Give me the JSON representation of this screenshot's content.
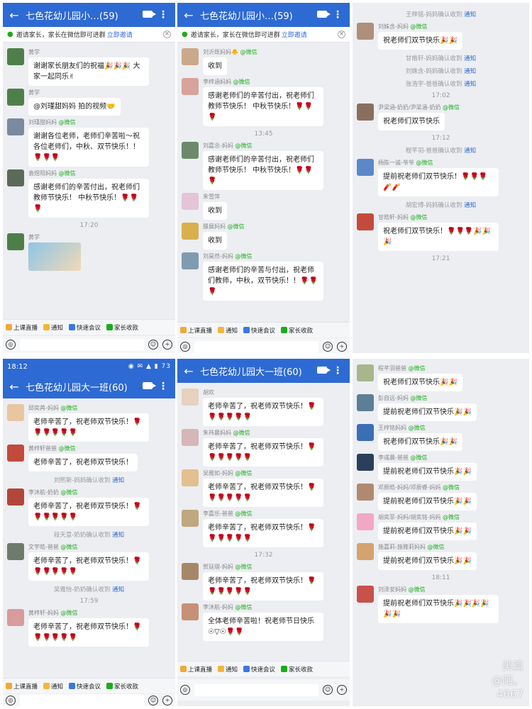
{
  "p1": {
    "title": "七色花幼儿园小…(59)",
    "invite_text": "邀请家长，家长在微信即可进群",
    "invite_link": "立即邀请",
    "messages": [
      {
        "sender": "黄学",
        "wx": "",
        "text": "谢谢家长朋友们的祝福🎉🎉🎉 大家一起同乐✌",
        "avatar": "#4f7f48"
      },
      {
        "sender": "黄学",
        "wx": "",
        "text": "@刘瑾甜妈妈 拍的视频🤝",
        "avatar": "#4f7f48"
      },
      {
        "sender": "刘瑾甜妈妈",
        "wx": "@微信",
        "text": "谢谢各位老师，老师们辛苦啦～祝各位老师们，中秋、双节快乐！！🌹🌹🌹",
        "avatar": "#7a8aa0"
      },
      {
        "sender": "袁煜阳妈妈",
        "wx": "@微信",
        "text": "感谢老师们的辛苦付出，祝老师们教师节快乐！ 中秋节快乐！🌹🌹🌹",
        "avatar": "#5d6a5a"
      }
    ],
    "time": "17:20",
    "last_sender": "黄学"
  },
  "p2": {
    "title": "七色花幼儿园小…(59)",
    "invite_text": "邀请家长，家长在微信即可进群",
    "invite_link": "立即邀请",
    "messages": [
      {
        "sender": "刘沂既妈妈🐥",
        "wx": "@微信",
        "text": "收到",
        "avatar": "#c9a98a"
      },
      {
        "sender": "李梓涵妈妈",
        "wx": "@微信",
        "text": "感谢老师们的辛苦付出，祝老师们教师节快乐！ 中秋节快乐！🌹🌹🌹",
        "avatar": "#d7a39b"
      }
    ],
    "time": "13:45",
    "messages2": [
      {
        "sender": "刘嘉念-妈妈",
        "wx": "@微信",
        "text": "感谢老师们的辛苦付出，祝老师们教师节快乐！ 中秋节快乐！🌹🌹🌹",
        "avatar": "#6c8a6a"
      },
      {
        "sender": "朱雪萍",
        "wx": "",
        "text": "收到",
        "avatar": "#e4c4d6"
      },
      {
        "sender": "滕展妈妈",
        "wx": "@微信",
        "text": "收到",
        "avatar": "#d8b04c"
      },
      {
        "sender": "刘昊然-妈妈",
        "wx": "@微信",
        "text": "感谢老师们的辛苦与付出，祝老师们教师，中秋，双节快乐！！🌹🌹🌹",
        "avatar": "#7f9bb0"
      }
    ]
  },
  "p3": {
    "sys_top": "王梓铭-妈妈确认收到",
    "notice": "通知",
    "items": [
      {
        "type": "msg",
        "sender": "刘姝含-妈妈",
        "wx": "@微信",
        "text": "祝老师们双节快乐🎉🎉",
        "avatar": "#b08f7a"
      },
      {
        "type": "sys",
        "text": "甘皓轩-妈妈确认收到"
      },
      {
        "type": "sys",
        "text": "刘姝含-妈妈确认收到"
      },
      {
        "type": "sys",
        "text": "张浩宇-爸爸确认收到"
      },
      {
        "type": "time",
        "text": "17:02"
      },
      {
        "type": "msg",
        "sender": "尹梁涵-奶奶/尹梁涵-奶奶",
        "wx": "@微信",
        "text": "祝老师们双节快乐",
        "avatar": "#8b6f5e"
      },
      {
        "type": "time",
        "text": "17:12"
      },
      {
        "type": "sys",
        "text": "程芊羽-爸爸确认收到"
      },
      {
        "type": "msg",
        "sender": "杨陈一诚-爷爷",
        "wx": "@微信",
        "text": "提前祝老师们双节快乐！🌹🌹🌹🧨🧨",
        "avatar": "#5c88c9"
      },
      {
        "type": "sys",
        "text": "胡宏博-妈妈确认收到"
      },
      {
        "type": "msg",
        "sender": "甘皓轩-妈妈",
        "wx": "@微信",
        "text": "祝老师们双节快乐！🌹🌹🌹🎉🎉🎉",
        "avatar": "#c44b3b"
      },
      {
        "type": "time",
        "text": "17:21"
      }
    ]
  },
  "p4": {
    "status_time": "18:12",
    "status_icons": "◉ ✉ ▲ ▮ 73",
    "title": "七色花幼儿园大一班(60)",
    "items": [
      {
        "type": "msg",
        "sender": "邱奕苒-妈妈",
        "wx": "@微信",
        "text": "老师辛苦了，祝老师双节快乐！🌹🌹🌹🌹🌹🌹",
        "avatar": "#e8c6a0"
      },
      {
        "type": "msg",
        "sender": "黄梓轩爸爸",
        "wx": "@微信",
        "text": "老师辛苦了，祝老师双节快乐！",
        "avatar": "#c24a3c"
      },
      {
        "type": "sys",
        "text": "刘熙新-妈妈确认收到"
      },
      {
        "type": "msg",
        "sender": "李沐航-奶奶",
        "wx": "@微信",
        "text": "老师辛苦了，祝老师双节快乐！🌹🌹🌹🌹🌹🌹",
        "avatar": "#b0473a"
      },
      {
        "type": "sys",
        "text": "段天意-奶奶确认收到"
      },
      {
        "type": "msg",
        "sender": "文宇皓-爸爸",
        "wx": "@微信",
        "text": "老师辛苦了，祝老师双节快乐！🌹🌹🌹🌹🌹🌹",
        "avatar": "#6f7a6b"
      },
      {
        "type": "sys",
        "text": "吴雅怡-奶奶确认收到"
      },
      {
        "type": "time",
        "text": "17:59"
      },
      {
        "type": "msg",
        "sender": "黄梓轩-妈妈",
        "wx": "@微信",
        "text": "老师辛苦了，祝老师双节快乐！🌹🌹🌹🌹🌹🌹",
        "avatar": "#d89a9a"
      }
    ]
  },
  "p5": {
    "title": "七色花幼儿园大一班(60)",
    "items": [
      {
        "type": "msg",
        "sender": "胡欢",
        "wx": "",
        "text": "老师辛苦了，祝老师双节快乐！🌹🌹🌹🌹🌹🌹",
        "avatar": "#e7d1bf"
      },
      {
        "type": "msg",
        "sender": "朱祎晨妈妈",
        "wx": "@微信",
        "text": "老师辛苦了，祝老师双节快乐！🌹🌹🌹🌹🌹🌹",
        "avatar": "#d6b6b6"
      },
      {
        "type": "msg",
        "sender": "吴雅如-妈妈",
        "wx": "@微信",
        "text": "老师辛苦了，祝老师双节快乐！🌹🌹🌹🌹🌹🌹",
        "avatar": "#e2c08f"
      },
      {
        "type": "msg",
        "sender": "李嘉乐-爸爸",
        "wx": "@微信",
        "text": "老师辛苦了，祝老师双节快乐！🌹🌹🌹🌹🌹🌹",
        "avatar": "#bfa77f"
      },
      {
        "type": "time",
        "text": "17:32"
      },
      {
        "type": "msg",
        "sender": "贺廷熠-妈妈",
        "wx": "@微信",
        "text": "老师辛苦了，祝老师双节快乐！🌹🌹🌹🌹🌹🌹",
        "avatar": "#a78866"
      },
      {
        "type": "msg",
        "sender": "李沐航-妈妈",
        "wx": "@微信",
        "text": "全体老师辛苦啦！祝老师节日快乐☉▽☉🌹🌹",
        "avatar": "#c79175"
      }
    ]
  },
  "p6": {
    "items": [
      {
        "type": "msg",
        "sender": "程芊羽爸爸",
        "wx": "@微信",
        "text": "祝老师们双节快乐🎉🎉",
        "avatar": "#a9b58a"
      },
      {
        "type": "msg",
        "sender": "彭自远-妈妈",
        "wx": "@微信",
        "text": "提前祝老师们双节快乐🎉🎉",
        "avatar": "#5c7f96"
      },
      {
        "type": "msg",
        "sender": "王梓铭妈妈",
        "wx": "@微信",
        "text": "祝老师们双节快乐🎉🎉",
        "avatar": "#3a6fb5"
      },
      {
        "type": "msg",
        "sender": "李彧晨-爸爸",
        "wx": "@微信",
        "text": "提前祝老师们双节快乐🎉🎉",
        "avatar": "#2a3f5a"
      },
      {
        "type": "msg",
        "sender": "邓辰皓-妈妈/邓辰睿-妈妈",
        "wx": "@微信",
        "text": "提前祝老师们双节快乐🎉🎉",
        "avatar": "#b08a6e"
      },
      {
        "type": "msg",
        "sender": "胡奕菲-妈妈/胡奕铭-妈妈",
        "wx": "@微信",
        "text": "提前祝老师们双节快乐🎉🎉",
        "avatar": "#f2a8c4"
      },
      {
        "type": "msg",
        "sender": "施嘉莉-施雅莉妈妈",
        "wx": "@微信",
        "text": "提前祝老师们双节快乐🎉🎉",
        "avatar": "#d4a36f"
      },
      {
        "type": "time",
        "text": "18:11"
      },
      {
        "type": "msg",
        "sender": "刘泽安妈妈",
        "wx": "@微信",
        "text": "提前祝老师们双节快乐🎉🎉🎉🎉🎉🎉",
        "avatar": "#c8514a"
      }
    ],
    "watermark_brand": "美篇",
    "watermark_user": "@陌。",
    "watermark_id": "4667"
  },
  "toolbar": {
    "live": "上课直播",
    "notice": "通知",
    "meeting": "快速会议",
    "fee": "家长收款"
  },
  "colors": {
    "primary": "#2d6ad3",
    "wechat": "#1aad19"
  }
}
